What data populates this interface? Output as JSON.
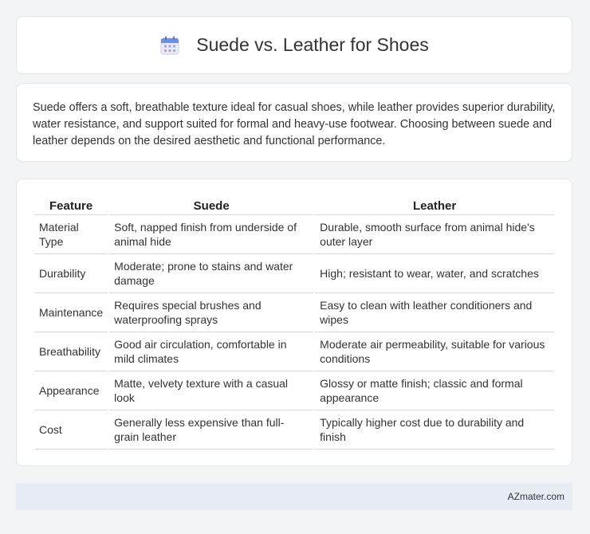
{
  "header": {
    "icon": "calendar-icon",
    "title": "Suede vs. Leather for Shoes"
  },
  "intro": {
    "text": "Suede offers a soft, breathable texture ideal for casual shoes, while leather provides superior durability, water resistance, and support suited for formal and heavy-use footwear. Choosing between suede and leather depends on the desired aesthetic and functional performance."
  },
  "table": {
    "headers": [
      "Feature",
      "Suede",
      "Leather"
    ],
    "rows": [
      [
        "Material Type",
        "Soft, napped finish from underside of animal hide",
        "Durable, smooth surface from animal hide's outer layer"
      ],
      [
        "Durability",
        "Moderate; prone to stains and water damage",
        "High; resistant to wear, water, and scratches"
      ],
      [
        "Maintenance",
        "Requires special brushes and waterproofing sprays",
        "Easy to clean with leather conditioners and wipes"
      ],
      [
        "Breathability",
        "Good air circulation, comfortable in mild climates",
        "Moderate air permeability, suitable for various conditions"
      ],
      [
        "Appearance",
        "Matte, velvety texture with a casual look",
        "Glossy or matte finish; classic and formal appearance"
      ],
      [
        "Cost",
        "Generally less expensive than full-grain leather",
        "Typically higher cost due to durability and finish"
      ]
    ]
  },
  "footer": {
    "text": "AZmater.com"
  }
}
